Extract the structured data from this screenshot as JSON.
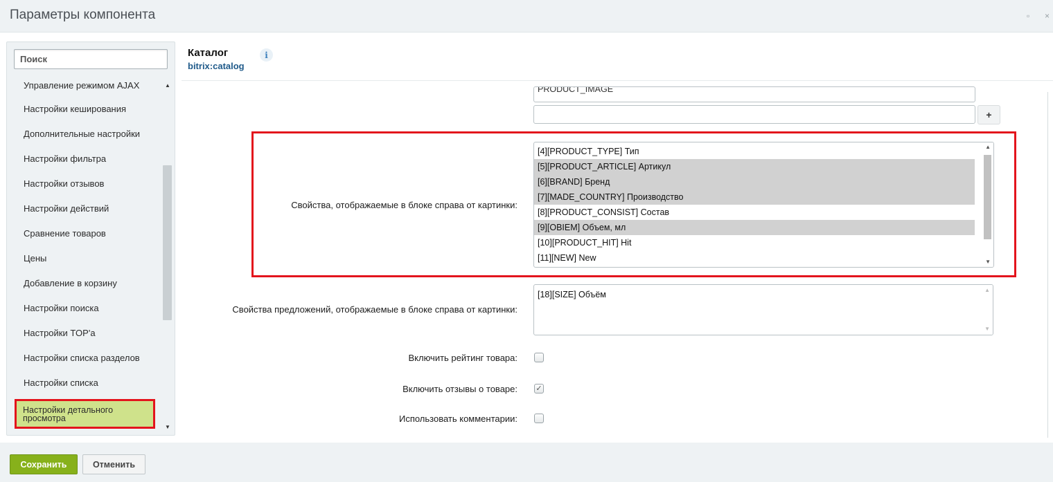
{
  "window": {
    "title": "Параметры компонента",
    "controls": [
      "▫",
      "×"
    ]
  },
  "sidebar": {
    "search_placeholder": "Поиск",
    "items": [
      {
        "label": "Управление режимом AJAX"
      },
      {
        "label": "Настройки кеширования"
      },
      {
        "label": "Дополнительные настройки"
      },
      {
        "label": "Настройки фильтра"
      },
      {
        "label": "Настройки отзывов"
      },
      {
        "label": "Настройки действий"
      },
      {
        "label": "Сравнение товаров"
      },
      {
        "label": "Цены"
      },
      {
        "label": "Добавление в корзину"
      },
      {
        "label": "Настройки поиска"
      },
      {
        "label": "Настройки TOP'а"
      },
      {
        "label": "Настройки списка разделов"
      },
      {
        "label": "Настройки списка"
      },
      {
        "label": "Настройки детального просмотра",
        "active": true
      }
    ]
  },
  "header": {
    "title": "Каталог",
    "subtitle": "bitrix:catalog",
    "info_icon": "i"
  },
  "fields": {
    "partial_value": "PRODUCT_IMAGE",
    "plus_label": "+",
    "properties_label": "Свойства, отображаемые в блоке справа от картинки:",
    "properties_options": [
      {
        "text": "[4][PRODUCT_TYPE] Тип",
        "selected": false
      },
      {
        "text": "[5][PRODUCT_ARTICLE] Артикул",
        "selected": true
      },
      {
        "text": "[6][BRAND] Бренд",
        "selected": true
      },
      {
        "text": "[7][MADE_COUNTRY] Производство",
        "selected": true
      },
      {
        "text": "[8][PRODUCT_CONSIST] Состав",
        "selected": false
      },
      {
        "text": "[9][OBIEM] Объем, мл",
        "selected": true
      },
      {
        "text": "[10][PRODUCT_HIT] Hit",
        "selected": false
      },
      {
        "text": "[11][NEW] New",
        "selected": false
      }
    ],
    "offers_label": "Свойства предложений, отображаемые в блоке справа от картинки:",
    "offers_options": [
      {
        "text": "[18][SIZE] Объём",
        "selected": false
      }
    ],
    "rating_label": "Включить рейтинг товара:",
    "rating_checked": false,
    "reviews_label": "Включить отзывы о товаре:",
    "reviews_checked": true,
    "comments_label": "Использовать комментарии:",
    "comments_checked": false
  },
  "footer": {
    "save_label": "Сохранить",
    "cancel_label": "Отменить"
  },
  "colors": {
    "highlight_border": "#e3141c",
    "active_item_bg": "#cfe28b",
    "save_button": "#87b11b",
    "link": "#1f5a8a"
  }
}
